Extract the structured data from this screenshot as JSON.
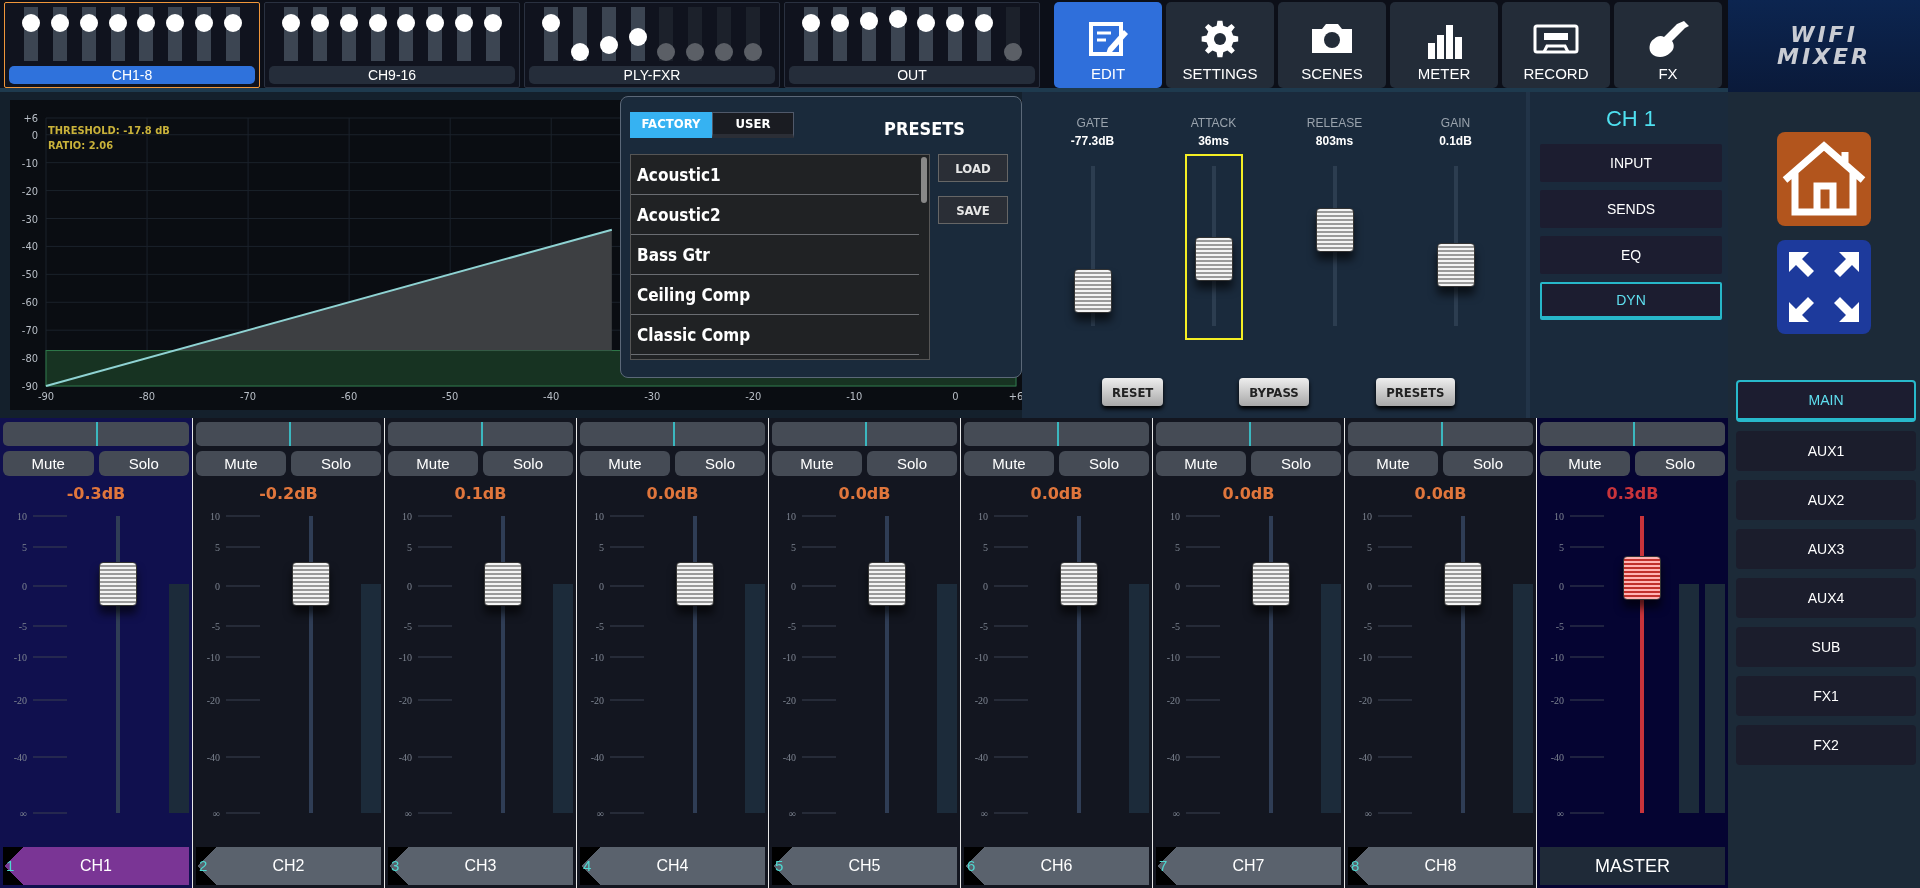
{
  "layer_banks": [
    {
      "label": "CH1-8",
      "selected": true,
      "faders": [
        {
          "level": 0.7,
          "disabled": false
        },
        {
          "level": 0.7,
          "disabled": false
        },
        {
          "level": 0.7,
          "disabled": false
        },
        {
          "level": 0.7,
          "disabled": false
        },
        {
          "level": 0.7,
          "disabled": false
        },
        {
          "level": 0.7,
          "disabled": false
        },
        {
          "level": 0.7,
          "disabled": false
        },
        {
          "level": 0.7,
          "disabled": false
        }
      ]
    },
    {
      "label": "CH9-16",
      "selected": false,
      "faders": [
        {
          "level": 0.7,
          "disabled": false
        },
        {
          "level": 0.7,
          "disabled": false
        },
        {
          "level": 0.7,
          "disabled": false
        },
        {
          "level": 0.7,
          "disabled": false
        },
        {
          "level": 0.7,
          "disabled": false
        },
        {
          "level": 0.7,
          "disabled": false
        },
        {
          "level": 0.7,
          "disabled": false
        },
        {
          "level": 0.7,
          "disabled": false
        }
      ]
    },
    {
      "label": "PLY-FXR",
      "selected": false,
      "faders": [
        {
          "level": 0.7,
          "disabled": false
        },
        {
          "level": 0.05,
          "disabled": false
        },
        {
          "level": 0.3,
          "disabled": false
        },
        {
          "level": 0.45,
          "disabled": false
        },
        {
          "level": 0.05,
          "disabled": true
        },
        {
          "level": 0.05,
          "disabled": true
        },
        {
          "level": 0.05,
          "disabled": true
        },
        {
          "level": 0.05,
          "disabled": true
        }
      ]
    },
    {
      "label": "OUT",
      "selected": false,
      "faders": [
        {
          "level": 0.7,
          "disabled": false
        },
        {
          "level": 0.7,
          "disabled": false
        },
        {
          "level": 0.75,
          "disabled": false
        },
        {
          "level": 0.78,
          "disabled": false
        },
        {
          "level": 0.7,
          "disabled": false
        },
        {
          "level": 0.7,
          "disabled": false
        },
        {
          "level": 0.7,
          "disabled": false
        },
        {
          "level": 0.05,
          "disabled": true
        }
      ]
    }
  ],
  "nav": [
    {
      "label": "EDIT",
      "kind": "edit",
      "selected": true
    },
    {
      "label": "SETTINGS",
      "kind": "settings",
      "selected": false
    },
    {
      "label": "SCENES",
      "kind": "camera",
      "selected": false
    },
    {
      "label": "METER",
      "kind": "meter",
      "selected": false
    },
    {
      "label": "RECORD",
      "kind": "cassette",
      "selected": false
    },
    {
      "label": "FX",
      "kind": "guitar",
      "selected": false
    }
  ],
  "logo": {
    "lines": [
      "WIFI",
      "MIXER"
    ]
  },
  "dynamics_graph": {
    "threshold_label": "THRESHOLD: -17.8 dB",
    "ratio_label": "RATIO: 2.06",
    "chart_data": {
      "type": "area",
      "x": [
        -90,
        -34
      ],
      "grid": true,
      "series": [
        {
          "color": "#8fd3d3",
          "values": [
            -90,
            -34
          ]
        }
      ],
      "xlim": [
        -90,
        6
      ],
      "ylim": [
        -90,
        6
      ],
      "xticks": [
        -90,
        -80,
        -70,
        -60,
        -50,
        -40,
        -30,
        -20,
        -10,
        0,
        {
          "value": 6,
          "label": "+6"
        }
      ],
      "yticks": [
        {
          "value": 6,
          "label": "+6"
        },
        0,
        -10,
        -20,
        -30,
        -40,
        -50,
        -60,
        -70,
        -80,
        -90
      ],
      "bands": [
        {
          "axis": "y",
          "from": -90,
          "to": -77.3
        }
      ]
    }
  },
  "presets": {
    "tabs": [
      {
        "label": "FACTORY",
        "selected": true
      },
      {
        "label": "USER",
        "selected": false
      }
    ],
    "title": "PRESETS",
    "items": [
      "Acoustic1",
      "Acoustic2",
      "Bass Gtr",
      "Ceiling Comp",
      "Classic Comp"
    ],
    "buttons": [
      "LOAD",
      "SAVE"
    ]
  },
  "dynamics": {
    "params": [
      {
        "label": "GATE",
        "value": "-77.3dB",
        "level": 0.22,
        "selected": false
      },
      {
        "label": "ATTACK",
        "value": "36ms",
        "level": 0.42,
        "selected": true
      },
      {
        "label": "RELEASE",
        "value": "803ms",
        "level": 0.6,
        "selected": false
      },
      {
        "label": "GAIN",
        "value": "0.1dB",
        "level": 0.38,
        "selected": false
      }
    ],
    "buttons": [
      "RESET",
      "BYPASS",
      "PRESETS"
    ]
  },
  "channel_panel": {
    "title": "CH 1",
    "tabs": [
      {
        "label": "INPUT",
        "selected": false
      },
      {
        "label": "SENDS",
        "selected": false
      },
      {
        "label": "EQ",
        "selected": false
      },
      {
        "label": "DYN",
        "selected": true
      }
    ]
  },
  "bus_select": [
    {
      "label": "MAIN",
      "selected": true
    },
    {
      "label": "AUX1",
      "selected": false
    },
    {
      "label": "AUX2",
      "selected": false
    },
    {
      "label": "AUX3",
      "selected": false
    },
    {
      "label": "AUX4",
      "selected": false
    },
    {
      "label": "SUB",
      "selected": false
    },
    {
      "label": "FX1",
      "selected": false
    },
    {
      "label": "FX2",
      "selected": false
    }
  ],
  "strips": [
    {
      "kind": "channel",
      "number": "1",
      "name": "CH1",
      "pan": {
        "level": 0.5
      },
      "selected": true,
      "mute": "Mute",
      "solo": "Solo",
      "gain": "-0.3dB",
      "level": 0.77,
      "scale": [
        "10",
        "5",
        "0",
        "-5",
        "-10",
        "-20",
        "-40",
        "∞"
      ]
    },
    {
      "kind": "channel",
      "number": "2",
      "name": "CH2",
      "pan": {
        "level": 0.5
      },
      "selected": false,
      "mute": "Mute",
      "solo": "Solo",
      "gain": "-0.2dB",
      "level": 0.77,
      "scale": [
        "10",
        "5",
        "0",
        "-5",
        "-10",
        "-20",
        "-40",
        "∞"
      ]
    },
    {
      "kind": "channel",
      "number": "3",
      "name": "CH3",
      "pan": {
        "level": 0.5
      },
      "selected": false,
      "mute": "Mute",
      "solo": "Solo",
      "gain": "0.1dB",
      "level": 0.77,
      "scale": [
        "10",
        "5",
        "0",
        "-5",
        "-10",
        "-20",
        "-40",
        "∞"
      ]
    },
    {
      "kind": "channel",
      "number": "4",
      "name": "CH4",
      "pan": {
        "level": 0.5
      },
      "selected": false,
      "mute": "Mute",
      "solo": "Solo",
      "gain": "0.0dB",
      "level": 0.77,
      "scale": [
        "10",
        "5",
        "0",
        "-5",
        "-10",
        "-20",
        "-40",
        "∞"
      ]
    },
    {
      "kind": "channel",
      "number": "5",
      "name": "CH5",
      "pan": {
        "level": 0.5
      },
      "selected": false,
      "mute": "Mute",
      "solo": "Solo",
      "gain": "0.0dB",
      "level": 0.77,
      "scale": [
        "10",
        "5",
        "0",
        "-5",
        "-10",
        "-20",
        "-40",
        "∞"
      ]
    },
    {
      "kind": "channel",
      "number": "6",
      "name": "CH6",
      "pan": {
        "level": 0.5
      },
      "selected": false,
      "mute": "Mute",
      "solo": "Solo",
      "gain": "0.0dB",
      "level": 0.77,
      "scale": [
        "10",
        "5",
        "0",
        "-5",
        "-10",
        "-20",
        "-40",
        "∞"
      ]
    },
    {
      "kind": "channel",
      "number": "7",
      "name": "CH7",
      "pan": {
        "level": 0.5
      },
      "selected": false,
      "mute": "Mute",
      "solo": "Solo",
      "gain": "0.0dB",
      "level": 0.77,
      "scale": [
        "10",
        "5",
        "0",
        "-5",
        "-10",
        "-20",
        "-40",
        "∞"
      ]
    },
    {
      "kind": "channel",
      "number": "8",
      "name": "CH8",
      "pan": {
        "level": 0.5
      },
      "selected": false,
      "mute": "Mute",
      "solo": "Solo",
      "gain": "0.0dB",
      "level": 0.77,
      "scale": [
        "10",
        "5",
        "0",
        "-5",
        "-10",
        "-20",
        "-40",
        "∞"
      ]
    },
    {
      "kind": "master",
      "name": "MASTER",
      "pan": {
        "level": 0.5
      },
      "selected": false,
      "mute": "Mute",
      "solo": "Solo",
      "gain": "0.3dB",
      "level": 0.79,
      "scale": [
        "10",
        "5",
        "0",
        "-5",
        "-10",
        "-20",
        "-40",
        "∞"
      ]
    }
  ]
}
